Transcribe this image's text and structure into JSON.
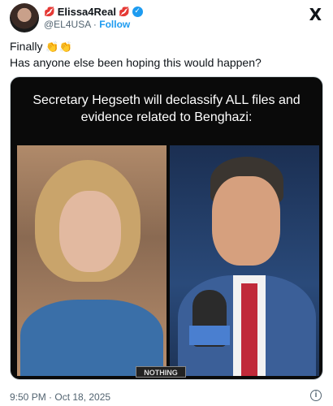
{
  "post": {
    "display_name": "Elissa4Real",
    "name_emoji_left": "💋",
    "name_emoji_right": "💋",
    "verified": "✓",
    "handle": "@EL4USA",
    "separator": "·",
    "follow_label": "Follow",
    "platform_icon": "X",
    "text_line1": "Finally",
    "clap_emoji": "👏👏",
    "text_line2": "Has anyone else been hoping this would happen?",
    "timestamp": "9:50 PM · Oct 18, 2025",
    "info_icon": "i"
  },
  "media": {
    "headline": "Secretary Hegseth will declassify ALL files and evidence related to Benghazi:",
    "watermark": "NOTHING",
    "background": "#0a0a0a"
  },
  "colors": {
    "accent": "#1d9bf0",
    "text_secondary": "#536471"
  }
}
